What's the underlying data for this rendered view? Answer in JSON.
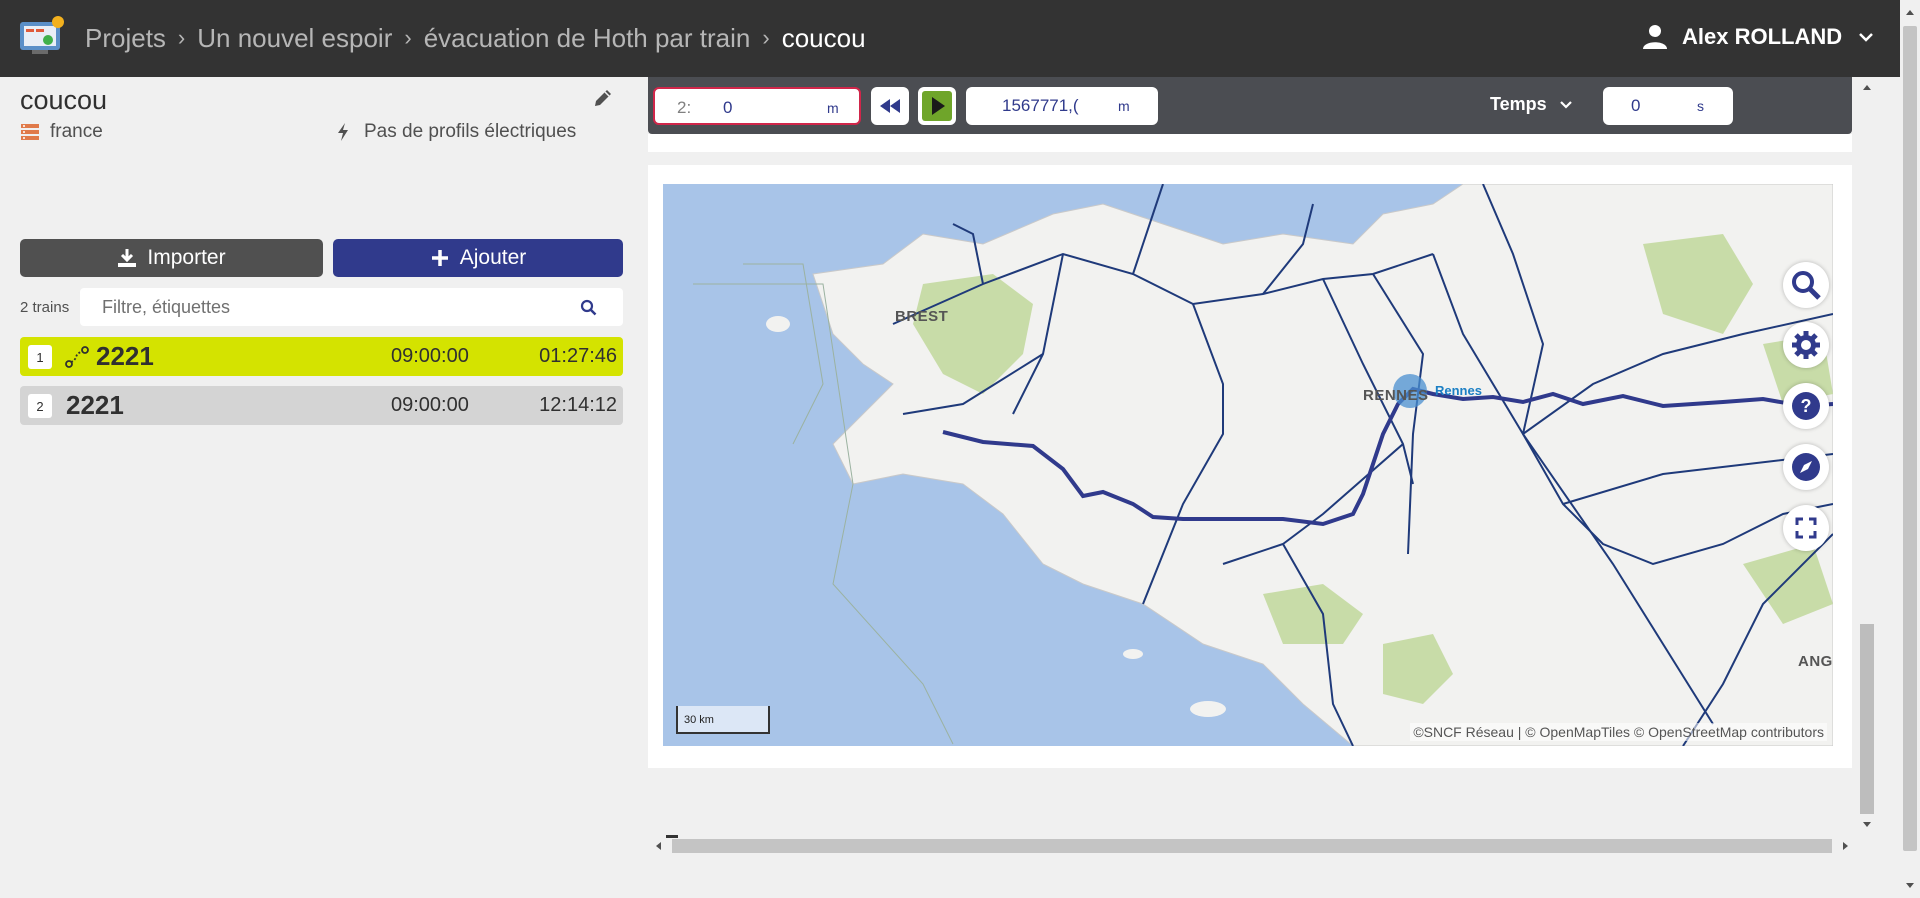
{
  "header": {
    "breadcrumb": [
      "Projets",
      "Un nouvel espoir",
      "évacuation de Hoth par train",
      "coucou"
    ],
    "user_name": "Alex ROLLAND"
  },
  "timetable": {
    "title": "coucou",
    "infra": "france",
    "electrical_profiles": "Pas de profils électriques",
    "import_label": "Importer",
    "add_label": "Ajouter",
    "trains_count": "2 trains",
    "filter_placeholder": "Filtre, étiquettes",
    "trains": [
      {
        "index": "1",
        "name": "2221",
        "departure": "09:00:00",
        "arrival": "01:27:46",
        "selected": true
      },
      {
        "index": "2",
        "name": "2221",
        "departure": "09:00:00",
        "arrival": "12:14:12",
        "selected": false
      }
    ]
  },
  "toolbar": {
    "position_value_a": "2:",
    "position_value_b": "0",
    "position_unit": "m",
    "distance_value": "1567771,(",
    "distance_unit": "m",
    "mode_label": "Temps",
    "time_value": "0",
    "time_unit": "s"
  },
  "map": {
    "cities": [
      "BREST",
      "RENNES",
      "Rennes",
      "ANG"
    ],
    "scale_label": "30 km",
    "attribution": "©SNCF Réseau | © OpenMapTiles © OpenStreetMap contributors",
    "colors": {
      "sea": "#a8c4e8",
      "land": "#f2f2f0",
      "route": "#303a8c",
      "rail": "#1f3a7a",
      "forest": "#c8dca8"
    }
  },
  "colors": {
    "header_bg": "#333333",
    "selected_row": "#d4e300",
    "primary": "#303a8c",
    "secondary_btn": "#505050"
  }
}
